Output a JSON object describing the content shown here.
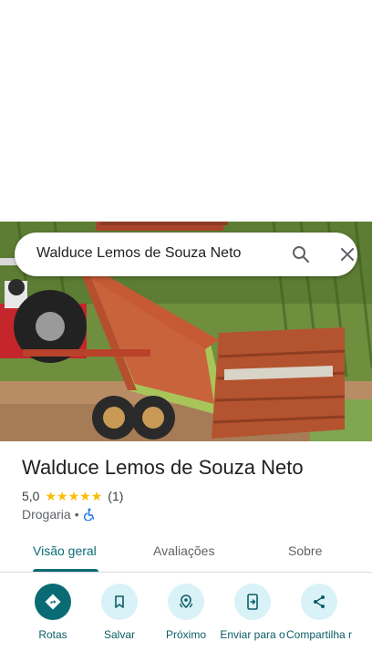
{
  "search": {
    "query": "Walduce Lemos de Souza Neto"
  },
  "place": {
    "title": "Walduce Lemos de Souza Neto",
    "rating": "5,0",
    "stars_filled": 5,
    "review_count": "(1)",
    "category": "Drogaria",
    "separator": "•"
  },
  "tabs": [
    {
      "label": "Visão geral",
      "active": true
    },
    {
      "label": "Avaliações",
      "active": false
    },
    {
      "label": "Sobre",
      "active": false
    }
  ],
  "actions": [
    {
      "label": "Rotas",
      "icon": "directions-icon"
    },
    {
      "label": "Salvar",
      "icon": "bookmark-icon"
    },
    {
      "label": "Próximo",
      "icon": "nearby-icon"
    },
    {
      "label": "Enviar para o",
      "icon": "send-to-phone-icon"
    },
    {
      "label": "Compartilha r",
      "icon": "share-icon"
    }
  ],
  "colors": {
    "accent": "#0b6b74",
    "action_bg": "#d9f2f7",
    "star": "#fbbc04"
  }
}
